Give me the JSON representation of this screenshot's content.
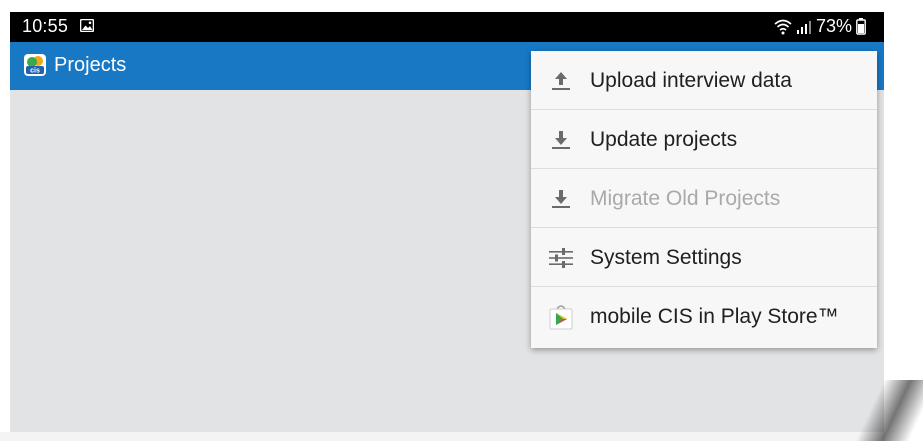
{
  "status_bar": {
    "time": "10:55",
    "battery_percent": "73%",
    "icons": [
      "gallery-icon",
      "wifi-icon",
      "signal-icon",
      "battery-icon"
    ]
  },
  "app_bar": {
    "title": "Projects",
    "logo_icon": "cis-app-logo-icon",
    "background_color": "#1878c4"
  },
  "overflow_menu": {
    "items": [
      {
        "label": "Upload interview data",
        "icon": "upload-icon",
        "enabled": true
      },
      {
        "label": "Update projects",
        "icon": "download-icon",
        "enabled": true
      },
      {
        "label": "Migrate Old Projects",
        "icon": "download-icon",
        "enabled": false
      },
      {
        "label": "System Settings",
        "icon": "sliders-icon",
        "enabled": true
      },
      {
        "label": "mobile CIS in Play Store™",
        "icon": "play-store-icon",
        "enabled": true
      }
    ]
  },
  "colors": {
    "content_background": "#e2e3e5",
    "menu_background": "#f7f7f7",
    "disabled_text": "#a9a9a9"
  }
}
